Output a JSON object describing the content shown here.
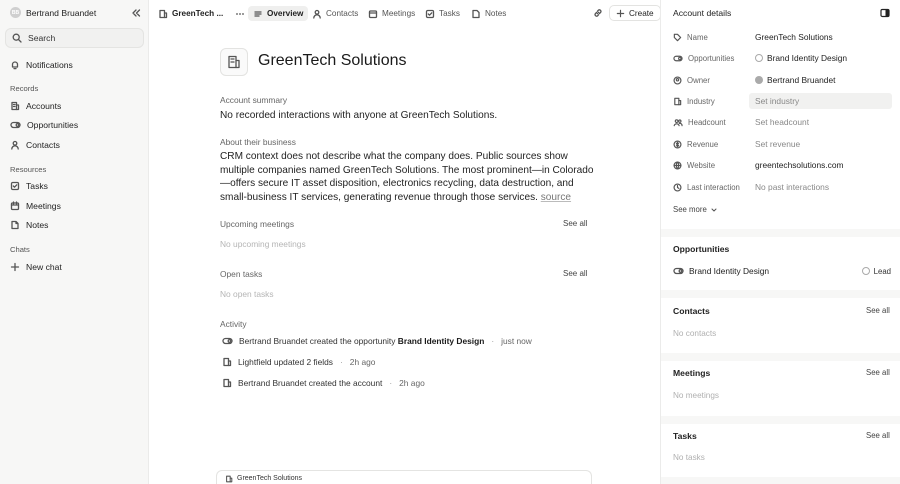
{
  "sidebar": {
    "user_initials": "BB",
    "user_name": "Bertrand Bruandet",
    "search_label": "Search",
    "notifications_label": "Notifications",
    "records_section": "Records",
    "records": [
      {
        "label": "Accounts",
        "icon": "building-icon"
      },
      {
        "label": "Opportunities",
        "icon": "toggle-icon"
      },
      {
        "label": "Contacts",
        "icon": "user-icon"
      }
    ],
    "resources_section": "Resources",
    "resources": [
      {
        "label": "Tasks",
        "icon": "checkbox-icon"
      },
      {
        "label": "Meetings",
        "icon": "calendar-icon"
      },
      {
        "label": "Notes",
        "icon": "note-icon"
      }
    ],
    "chats_section": "Chats",
    "new_chat_label": "New chat"
  },
  "topbar": {
    "record_title": "GreenTech ...",
    "tabs": [
      "Overview",
      "Contacts",
      "Meetings",
      "Tasks",
      "Notes"
    ],
    "active_tab": "Overview",
    "create_label": "Create"
  },
  "main": {
    "company_name": "GreenTech Solutions",
    "summary_label": "Account summary",
    "summary_text": "No recorded interactions with anyone at GreenTech Solutions.",
    "about_label": "About their business",
    "about_text": "CRM context does not describe what the company does. Public sources show multiple companies named GreenTech Solutions. The most prominent—in Colorado—offers secure IT asset disposition, electronics recycling, data destruction, and small-business IT services, generating revenue through those services.",
    "source_label": "source",
    "upcoming_label": "Upcoming meetings",
    "upcoming_empty": "No upcoming meetings",
    "tasks_label": "Open tasks",
    "tasks_empty": "No open tasks",
    "see_all": "See all",
    "activity_label": "Activity",
    "activity": [
      {
        "text": "Bertrand Bruandet created the opportunity",
        "bold": "Brand Identity Design",
        "time": "just now",
        "icon": "toggle-icon"
      },
      {
        "text": "Lightfield updated 2 fields",
        "bold": "",
        "time": "2h ago",
        "icon": "building-icon"
      },
      {
        "text": "Bertrand Bruandet created the account",
        "bold": "",
        "time": "2h ago",
        "icon": "building-icon"
      }
    ],
    "bottom_bar_label": "GreenTech Solutions"
  },
  "right_panel": {
    "title": "Account details",
    "fields": [
      {
        "label": "Name",
        "value": "GreenTech Solutions",
        "icon": "tag-icon"
      },
      {
        "label": "Opportunities",
        "value": "Brand Identity Design",
        "icon": "toggle-icon"
      },
      {
        "label": "Owner",
        "value": "Bertrand Bruandet",
        "icon": "user-circle-icon"
      },
      {
        "label": "Industry",
        "value": "Set industry",
        "icon": "building-icon"
      },
      {
        "label": "Headcount",
        "value": "Set headcount",
        "icon": "people-icon"
      },
      {
        "label": "Revenue",
        "value": "Set revenue",
        "icon": "dollar-icon"
      },
      {
        "label": "Website",
        "value": "greentechsolutions.com",
        "icon": "globe-icon"
      },
      {
        "label": "Last interaction",
        "value": "No past interactions",
        "icon": "clock-icon"
      }
    ],
    "see_more": "See more",
    "opportunities_heading": "Opportunities",
    "opportunity_name": "Brand Identity Design",
    "opportunity_stage": "Lead",
    "contacts_heading": "Contacts",
    "contacts_empty": "No contacts",
    "meetings_heading": "Meetings",
    "meetings_empty": "No meetings",
    "tasks_heading": "Tasks",
    "tasks_empty": "No tasks",
    "see_all": "See all"
  }
}
